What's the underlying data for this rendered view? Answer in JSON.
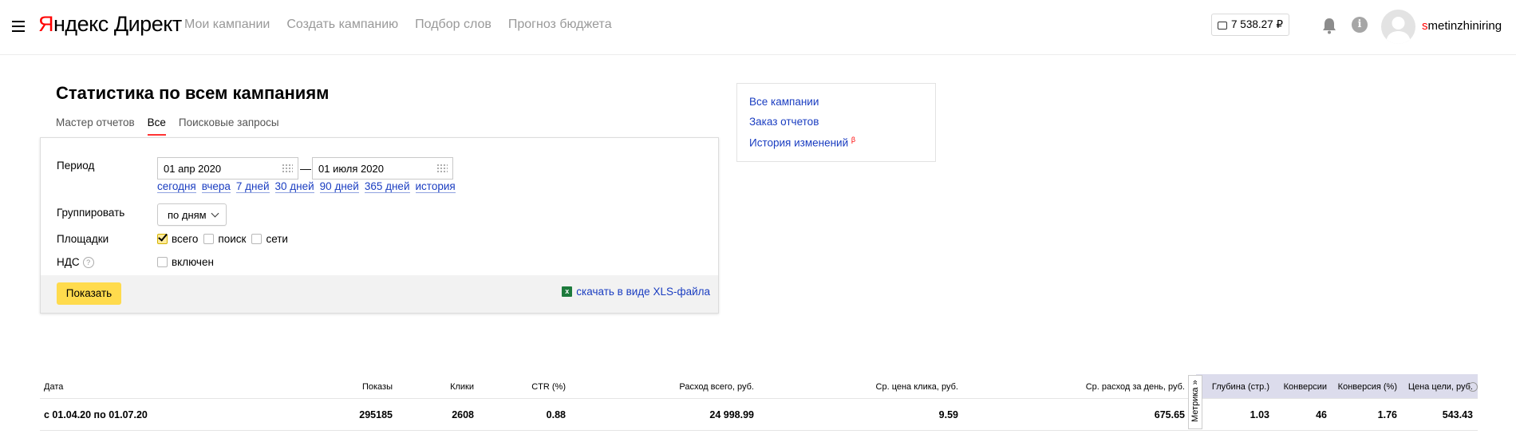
{
  "header": {
    "logo_main": "Яндекс",
    "logo_sub": "Директ",
    "nav": [
      "Мои кампании",
      "Создать кампанию",
      "Подбор слов",
      "Прогноз бюджета"
    ],
    "balance": "7 538.27 ₽",
    "username_first": "s",
    "username_rest": "metinzhiniring"
  },
  "page": {
    "title": "Статистика по всем кампаниям",
    "tabs": [
      "Мастер отчетов",
      "Все",
      "Поисковые запросы"
    ],
    "active_tab": "Все"
  },
  "filters": {
    "period_label": "Период",
    "date_from": "01 апр 2020",
    "date_to": "01 июля 2020",
    "dash": "—",
    "quick_periods": [
      "сегодня",
      "вчера",
      "7 дней",
      "30 дней",
      "90 дней",
      "365 дней",
      "история"
    ],
    "group_label": "Группировать",
    "group_value": "по дням",
    "platforms_label": "Площадки",
    "platforms": [
      {
        "label": "всего",
        "checked": true
      },
      {
        "label": "поиск",
        "checked": false
      },
      {
        "label": "сети",
        "checked": false
      }
    ],
    "vat_label": "НДС",
    "vat_help": "?",
    "vat_option": "включен",
    "show_button": "Показать",
    "xls_link": "скачать в виде XLS-файла"
  },
  "side_links": {
    "all_campaigns": "Все кампании",
    "report_order": "Заказ отчетов",
    "change_history": "История изменений",
    "beta": "β"
  },
  "table": {
    "columns": [
      "Дата",
      "Показы",
      "Клики",
      "CTR (%)",
      "Расход всего, руб.",
      "Ср. цена клика, руб.",
      "Ср. расход за день, руб.",
      "Глубина (стр.)",
      "Конверсии",
      "Конверсия (%)",
      "Цена цели, руб."
    ],
    "metrika_tab": "Метрика »",
    "rows": [
      [
        "с 01.04.20 по 01.07.20",
        "295185",
        "2608",
        "0.88",
        "24 998.99",
        "9.59",
        "675.65",
        "1.03",
        "46",
        "1.76",
        "543.43"
      ]
    ]
  }
}
